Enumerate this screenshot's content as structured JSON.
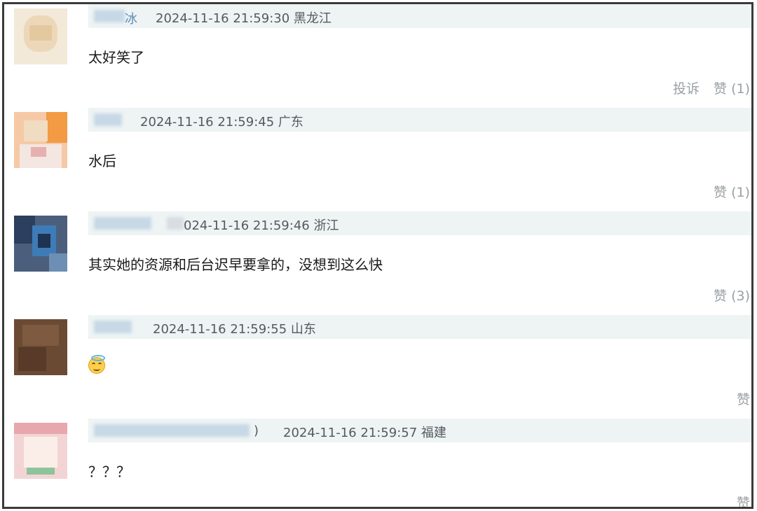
{
  "comments": [
    {
      "username_visible": "冰",
      "meta": "2024-11-16 21:59:30 黑龙江",
      "text": "太好笑了",
      "actions": [
        "投诉",
        "赞 (1)"
      ]
    },
    {
      "username_visible": "",
      "meta": "2024-11-16 21:59:45 广东",
      "text": "水后",
      "actions": [
        "赞 (1)"
      ]
    },
    {
      "username_visible": "",
      "meta": "024-11-16 21:59:46 浙江",
      "text": "其实她的资源和后台迟早要拿的，没想到这么快",
      "actions": [
        "赞 (3)"
      ]
    },
    {
      "username_visible": "",
      "meta": "2024-11-16 21:59:55 山东",
      "text": "",
      "emoji": "smiling-face-with-halo",
      "actions": [
        "赞"
      ]
    },
    {
      "username_visible": ")",
      "meta": "2024-11-16 21:59:57 福建",
      "text": "？？？",
      "actions": [
        "赞"
      ]
    }
  ],
  "colors": {
    "meta_bar": "#eef3f4",
    "username": "#5b8db6",
    "meta_text": "#555a5e",
    "action_text": "#9aa0a4",
    "frame_border": "#3a3a3a"
  }
}
